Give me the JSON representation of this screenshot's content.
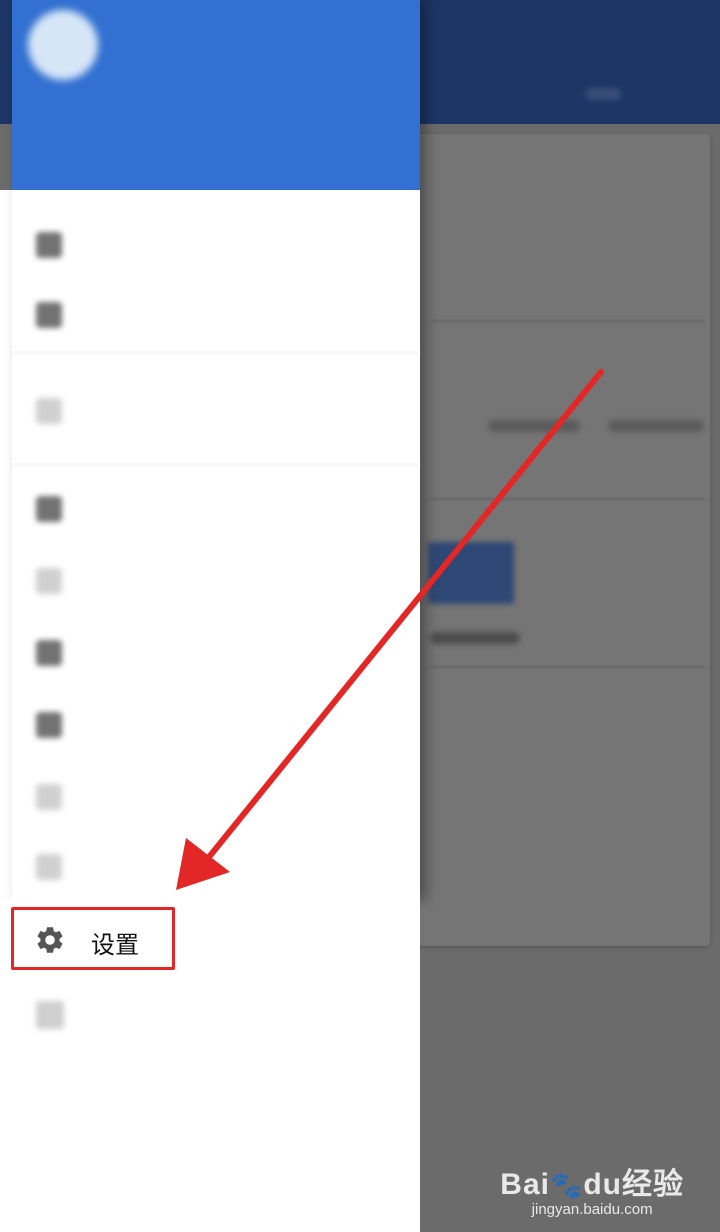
{
  "background_app": {
    "topbar_color": "#1d3666",
    "primary_button_color": "#2f4775"
  },
  "drawer": {
    "header_color": "#3270d1",
    "account_name": "",
    "blurred_items": [
      {
        "label": "",
        "icon": "account-icon"
      },
      {
        "label": "",
        "icon": "inbox-icon"
      },
      {
        "label": "",
        "icon": "star-icon"
      },
      {
        "label": "",
        "icon": "folder-icon"
      },
      {
        "label": "",
        "icon": "folder-outline-icon"
      },
      {
        "label": "",
        "icon": "tag-icon"
      },
      {
        "label": "",
        "icon": "tag-icon"
      },
      {
        "label": "",
        "icon": "label-icon"
      },
      {
        "label": "",
        "icon": "download-icon"
      }
    ],
    "settings": {
      "label": "设置",
      "icon": "gear-icon"
    },
    "last_item": {
      "label": "",
      "icon": "info-icon"
    }
  },
  "annotation": {
    "arrow_color": "#e32626",
    "highlight_color": "#e32626"
  },
  "watermark": {
    "logo_text": "Bai",
    "logo_mid": "du",
    "logo_cn": "经验",
    "subtitle": "jingyan.baidu.com"
  }
}
